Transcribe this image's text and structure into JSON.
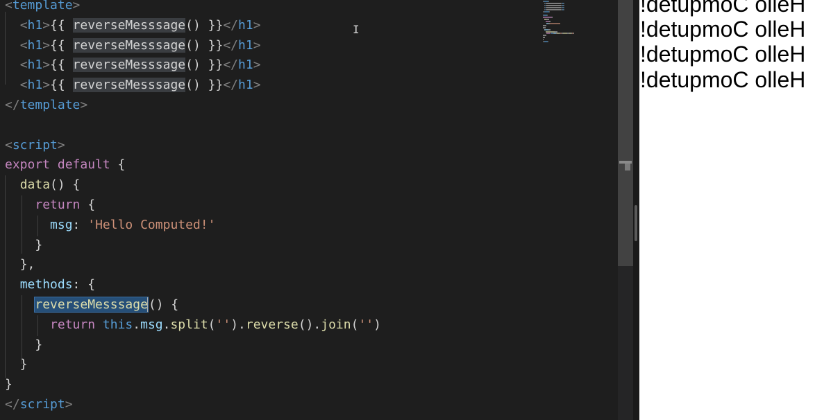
{
  "editor": {
    "lines": [
      {
        "tokens": [
          {
            "t": "<",
            "c": "punct"
          },
          {
            "t": "template",
            "c": "tag"
          },
          {
            "t": ">",
            "c": "punct"
          }
        ]
      },
      {
        "tokens": [
          {
            "t": "  ",
            "c": "plain"
          },
          {
            "t": "<",
            "c": "punct"
          },
          {
            "t": "h1",
            "c": "tag"
          },
          {
            "t": ">",
            "c": "punct"
          },
          {
            "t": "{{ ",
            "c": "plain"
          },
          {
            "t": "reverseMesssage",
            "c": "plain hl"
          },
          {
            "t": "() }}",
            "c": "plain"
          },
          {
            "t": "</",
            "c": "punct"
          },
          {
            "t": "h1",
            "c": "tag"
          },
          {
            "t": ">",
            "c": "punct"
          }
        ]
      },
      {
        "tokens": [
          {
            "t": "  ",
            "c": "plain"
          },
          {
            "t": "<",
            "c": "punct"
          },
          {
            "t": "h1",
            "c": "tag"
          },
          {
            "t": ">",
            "c": "punct"
          },
          {
            "t": "{{ ",
            "c": "plain"
          },
          {
            "t": "reverseMesssage",
            "c": "plain hl"
          },
          {
            "t": "() }}",
            "c": "plain"
          },
          {
            "t": "</",
            "c": "punct"
          },
          {
            "t": "h1",
            "c": "tag"
          },
          {
            "t": ">",
            "c": "punct"
          }
        ]
      },
      {
        "tokens": [
          {
            "t": "  ",
            "c": "plain"
          },
          {
            "t": "<",
            "c": "punct"
          },
          {
            "t": "h1",
            "c": "tag"
          },
          {
            "t": ">",
            "c": "punct"
          },
          {
            "t": "{{ ",
            "c": "plain"
          },
          {
            "t": "reverseMesssage",
            "c": "plain hl"
          },
          {
            "t": "() }}",
            "c": "plain"
          },
          {
            "t": "</",
            "c": "punct"
          },
          {
            "t": "h1",
            "c": "tag"
          },
          {
            "t": ">",
            "c": "punct"
          }
        ]
      },
      {
        "tokens": [
          {
            "t": "  ",
            "c": "plain"
          },
          {
            "t": "<",
            "c": "punct"
          },
          {
            "t": "h1",
            "c": "tag"
          },
          {
            "t": ">",
            "c": "punct"
          },
          {
            "t": "{{ ",
            "c": "plain"
          },
          {
            "t": "reverseMesssage",
            "c": "plain hl"
          },
          {
            "t": "() }}",
            "c": "plain"
          },
          {
            "t": "</",
            "c": "punct"
          },
          {
            "t": "h1",
            "c": "tag"
          },
          {
            "t": ">",
            "c": "punct"
          }
        ]
      },
      {
        "tokens": [
          {
            "t": "</",
            "c": "punct"
          },
          {
            "t": "template",
            "c": "tag"
          },
          {
            "t": ">",
            "c": "punct"
          }
        ]
      },
      {
        "tokens": []
      },
      {
        "tokens": [
          {
            "t": "<",
            "c": "punct"
          },
          {
            "t": "script",
            "c": "tag"
          },
          {
            "t": ">",
            "c": "punct"
          }
        ]
      },
      {
        "tokens": [
          {
            "t": "export default",
            "c": "kw"
          },
          {
            "t": " {",
            "c": "plain"
          }
        ]
      },
      {
        "tokens": [
          {
            "t": "  ",
            "c": "plain"
          },
          {
            "t": "data",
            "c": "fn"
          },
          {
            "t": "() {",
            "c": "plain"
          }
        ]
      },
      {
        "tokens": [
          {
            "t": "    ",
            "c": "plain"
          },
          {
            "t": "return",
            "c": "kw"
          },
          {
            "t": " {",
            "c": "plain"
          }
        ]
      },
      {
        "tokens": [
          {
            "t": "      ",
            "c": "plain"
          },
          {
            "t": "msg",
            "c": "prop"
          },
          {
            "t": ": ",
            "c": "plain"
          },
          {
            "t": "'Hello Computed!'",
            "c": "str"
          }
        ]
      },
      {
        "tokens": [
          {
            "t": "    }",
            "c": "plain"
          }
        ]
      },
      {
        "tokens": [
          {
            "t": "  },",
            "c": "plain"
          }
        ]
      },
      {
        "tokens": [
          {
            "t": "  ",
            "c": "plain"
          },
          {
            "t": "methods",
            "c": "prop"
          },
          {
            "t": ": {",
            "c": "plain"
          }
        ]
      },
      {
        "tokens": [
          {
            "t": "    ",
            "c": "plain"
          },
          {
            "t": "reverseMesssage",
            "c": "fn sel"
          },
          {
            "t": "",
            "c": "cursor"
          },
          {
            "t": "() {",
            "c": "plain"
          }
        ]
      },
      {
        "tokens": [
          {
            "t": "      ",
            "c": "plain"
          },
          {
            "t": "return",
            "c": "kw"
          },
          {
            "t": " ",
            "c": "plain"
          },
          {
            "t": "this",
            "c": "this"
          },
          {
            "t": ".",
            "c": "plain"
          },
          {
            "t": "msg",
            "c": "prop"
          },
          {
            "t": ".",
            "c": "plain"
          },
          {
            "t": "split",
            "c": "fn"
          },
          {
            "t": "(",
            "c": "plain"
          },
          {
            "t": "''",
            "c": "str"
          },
          {
            "t": ").",
            "c": "plain"
          },
          {
            "t": "reverse",
            "c": "fn"
          },
          {
            "t": "().",
            "c": "plain"
          },
          {
            "t": "join",
            "c": "fn"
          },
          {
            "t": "(",
            "c": "plain"
          },
          {
            "t": "''",
            "c": "str"
          },
          {
            "t": ")",
            "c": "plain"
          }
        ]
      },
      {
        "tokens": [
          {
            "t": "    }",
            "c": "plain"
          }
        ]
      },
      {
        "tokens": [
          {
            "t": "  }",
            "c": "plain"
          }
        ]
      },
      {
        "tokens": [
          {
            "t": "}",
            "c": "plain"
          }
        ]
      },
      {
        "tokens": [
          {
            "t": "</",
            "c": "punct"
          },
          {
            "t": "script",
            "c": "tag"
          },
          {
            "t": ">",
            "c": "punct"
          }
        ]
      }
    ],
    "cursor_glyph": "I"
  },
  "preview": {
    "headings": [
      "!detupmoC olleH",
      "!detupmoC olleH",
      "!detupmoC olleH",
      "!detupmoC olleH"
    ]
  },
  "colors": {
    "editor_bg": "#1e1e1e",
    "selection": "#264f78",
    "preview_bg": "#ffffff"
  }
}
